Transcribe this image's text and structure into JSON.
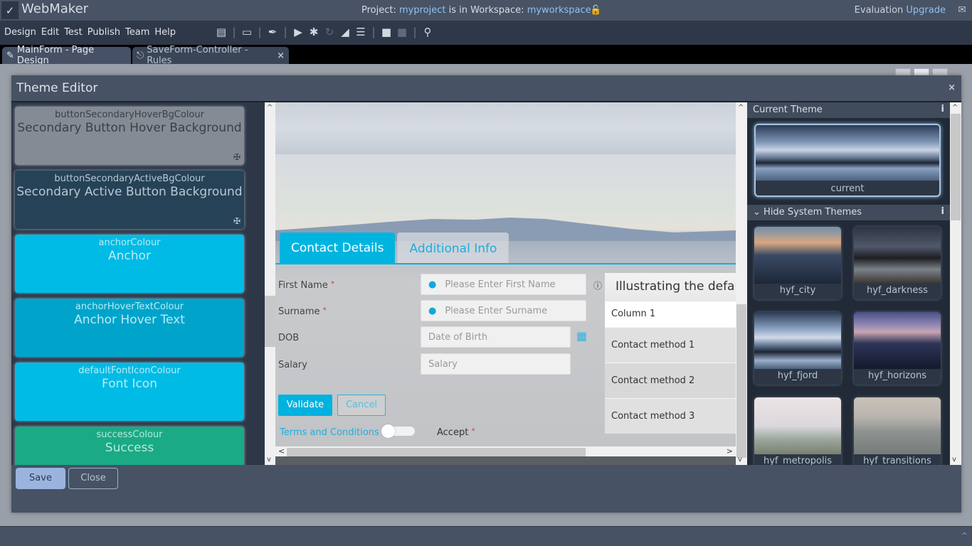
{
  "titlebar": {
    "app_name": "WebMaker",
    "project_prefix": "Project: ",
    "project_name": "myproject",
    "workspace_prefix": " is in Workspace: ",
    "workspace_name": "myworkspace",
    "lock_icon": "unlock-icon",
    "evaluation_label": "Evaluation",
    "upgrade_link": "Upgrade",
    "mail_icon": "mail-icon"
  },
  "menubar": {
    "menus": [
      "Design",
      "Edit",
      "Test",
      "Publish",
      "Team",
      "Help"
    ],
    "tools": [
      {
        "name": "save-icon",
        "glyph": "🖫"
      },
      {
        "name": "monitor-icon",
        "glyph": "▭"
      },
      {
        "name": "brush-icon",
        "glyph": "🖌"
      },
      {
        "name": "play-icon",
        "glyph": "▶"
      },
      {
        "name": "bug-icon",
        "glyph": "✱"
      },
      {
        "name": "refresh-icon",
        "glyph": "↻"
      },
      {
        "name": "eraser-icon",
        "glyph": "◢"
      },
      {
        "name": "server-icon",
        "glyph": "☰"
      },
      {
        "name": "lock-icon",
        "glyph": "🔒"
      },
      {
        "name": "unlock-icon",
        "glyph": "🔓"
      },
      {
        "name": "lightbulb-icon",
        "glyph": "💡"
      }
    ]
  },
  "tabs": [
    {
      "label": "MainForm - Page Design",
      "icon": "edit-icon",
      "active": true
    },
    {
      "label": "SaveForm-Controller - Rules",
      "icon": "sitemap-icon",
      "active": false,
      "close": "×"
    }
  ],
  "theme_editor": {
    "title": "Theme Editor",
    "close": "×",
    "colour_cards": [
      {
        "key": "buttonSecondaryHoverBgColour",
        "label": "Secondary Button Hover Background",
        "bg": "#858b94",
        "fg": "#3a3f47",
        "unlinked": true
      },
      {
        "key": "buttonSecondaryActiveBgColour",
        "label": "Secondary Active Button Background",
        "bg": "#264256",
        "fg": "#b8c8d4",
        "unlinked": true
      },
      {
        "key": "anchorColour",
        "label": "Anchor",
        "bg": "#00bbe5",
        "fg": "#b6ecf8",
        "unlinked": false
      },
      {
        "key": "anchorHoverTextColour",
        "label": "Anchor Hover Text",
        "bg": "#00a4ca",
        "fg": "#b6ecf8",
        "unlinked": false
      },
      {
        "key": "defaultFontIconColour",
        "label": "Font Icon",
        "bg": "#00bbe5",
        "fg": "#b6ecf8",
        "unlinked": false
      },
      {
        "key": "successColour",
        "label": "Success",
        "bg": "#1aaa86",
        "fg": "#b4ecd9",
        "unlinked": false
      }
    ],
    "preview": {
      "tabs": [
        "Contact Details",
        "Additional Info"
      ],
      "fields": [
        {
          "label": "First Name",
          "required": true,
          "placeholder": "Please Enter First Name",
          "icon": "user-icon",
          "info": true
        },
        {
          "label": "Surname",
          "required": true,
          "placeholder": "Please Enter Surname",
          "icon": "user-icon",
          "info": false
        },
        {
          "label": "DOB",
          "required": false,
          "placeholder": "Date of Birth",
          "icon": null,
          "calendar": true
        },
        {
          "label": "Salary",
          "required": false,
          "placeholder": "Salary",
          "icon": null
        }
      ],
      "validate_label": "Validate",
      "cancel_label": "Cancel",
      "terms_label": "Terms and Conditions",
      "accept_label": "Accept",
      "toggle_on": false,
      "grid": {
        "title": "Illustrating the defau",
        "column": "Column 1",
        "rows": [
          "Contact method 1",
          "Contact method 2",
          "Contact method 3"
        ]
      }
    },
    "current_theme": {
      "header": "Current Theme",
      "name": "current"
    },
    "system_themes": {
      "header": "Hide System Themes",
      "items": [
        "hyf_city",
        "hyf_darkness",
        "hyf_fjord",
        "hyf_horizons",
        "hyf_metropolis",
        "hyf_transitions"
      ]
    },
    "save_label": "Save",
    "close_label": "Close"
  }
}
